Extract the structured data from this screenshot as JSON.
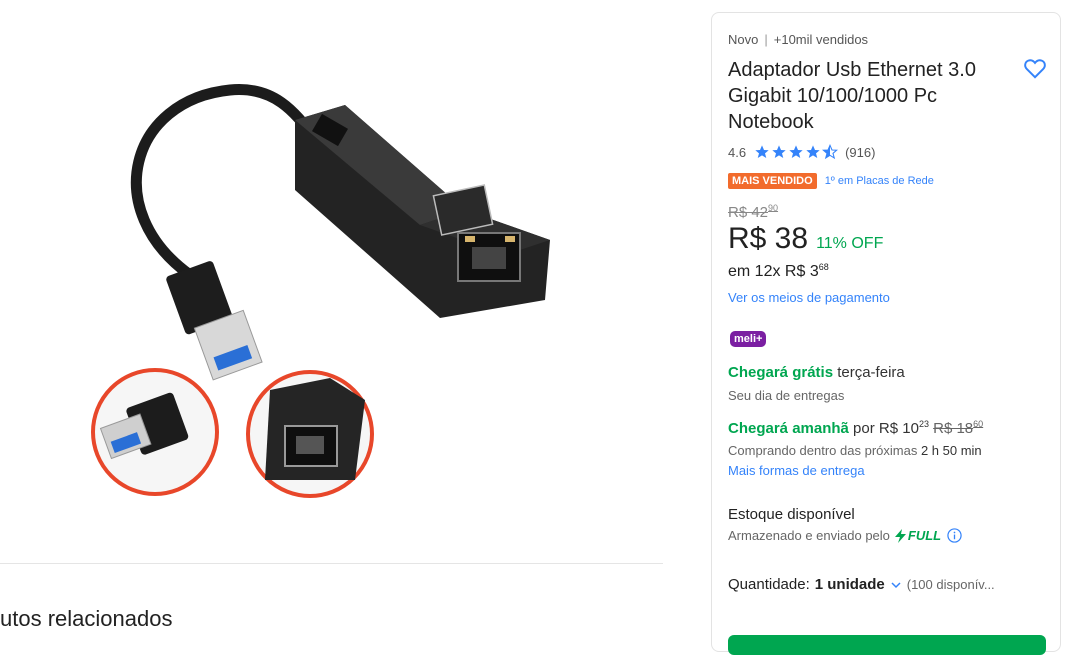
{
  "left": {
    "related_title": "utos relacionados"
  },
  "product": {
    "condition": "Novo",
    "sold": "+10mil vendidos",
    "title": "Adaptador Usb Ethernet 3.0 Gigabit 10/100/1000 Pc Notebook",
    "rating": {
      "value": "4.6",
      "stars": 4.5,
      "count": "(916)"
    },
    "badge": "MAIS VENDIDO",
    "rank": "1º em Placas de Rede",
    "old_price": {
      "int": "R$ 42",
      "cents": "90"
    },
    "price": "R$ 38",
    "discount": "11% OFF",
    "installments": {
      "text": "em 12x R$ 3",
      "cents": "68"
    },
    "payment_link": "Ver os meios de pagamento",
    "meli_plus": "meli+",
    "shipping_free": {
      "highlight": "Chegará grátis",
      "day": " terça-feira",
      "sub": "Seu dia de entregas"
    },
    "shipping_fast": {
      "highlight": "Chegará amanhã",
      "pre": " por R$ 10",
      "cents": "23",
      "old_int": "R$ 18",
      "old_cents": "60",
      "sub": "Comprando dentro das próximas ",
      "sub_time": "2 h 50 min",
      "link": "Mais formas de entrega"
    },
    "stock": "Estoque disponível",
    "stored": "Armazenado e enviado pelo",
    "full": "FULL",
    "quantity": {
      "label": "Quantidade:",
      "value": "1 unidade",
      "available": "(100 disponív..."
    },
    "colors": {
      "accent": "#3483fa",
      "green": "#00a650",
      "badge": "#f26b2c",
      "meli": "#7b1fa2"
    }
  }
}
